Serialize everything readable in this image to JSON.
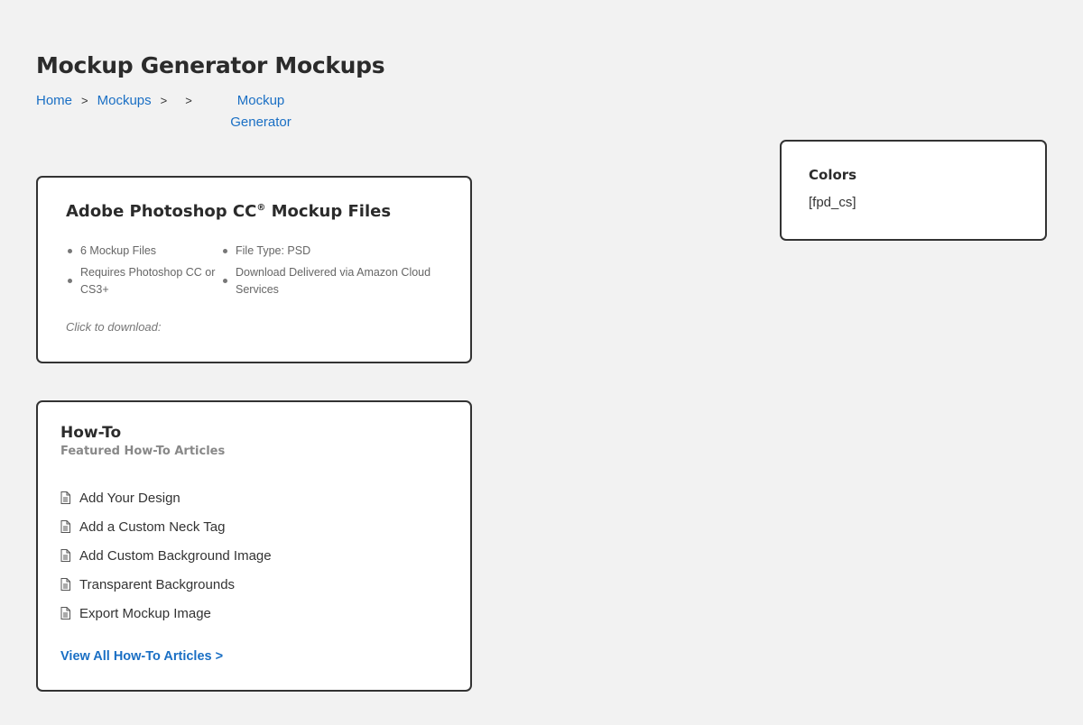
{
  "page": {
    "title": "Mockup Generator Mockups"
  },
  "breadcrumb": {
    "home": "Home",
    "mockups": "Mockups",
    "separator": ">",
    "current": "Mockup Generator"
  },
  "psd_card": {
    "title": "Adobe Photoshop CC",
    "registered_mark": "®",
    "title_suffix": " Mockup Files",
    "features": [
      "6 Mockup Files",
      "File Type: PSD",
      "Requires Photoshop CC or CS3+",
      "Download Delivered via Amazon Cloud Services"
    ],
    "click_to_download": "Click to download:"
  },
  "howto_card": {
    "title": "How-To",
    "subtitle": "Featured How-To Articles",
    "articles": [
      "Add Your Design",
      "Add a Custom Neck Tag",
      "Add Custom Background Image",
      "Transparent Backgrounds",
      "Export Mockup Image"
    ],
    "view_all": "View All How-To Articles >"
  },
  "colors_card": {
    "title": "Colors",
    "shortcode": "[fpd_cs]"
  },
  "icons": {
    "article": "document-icon"
  },
  "colors": {
    "link": "#1a6fc4",
    "border": "#333333",
    "background": "#f2f2f2"
  }
}
